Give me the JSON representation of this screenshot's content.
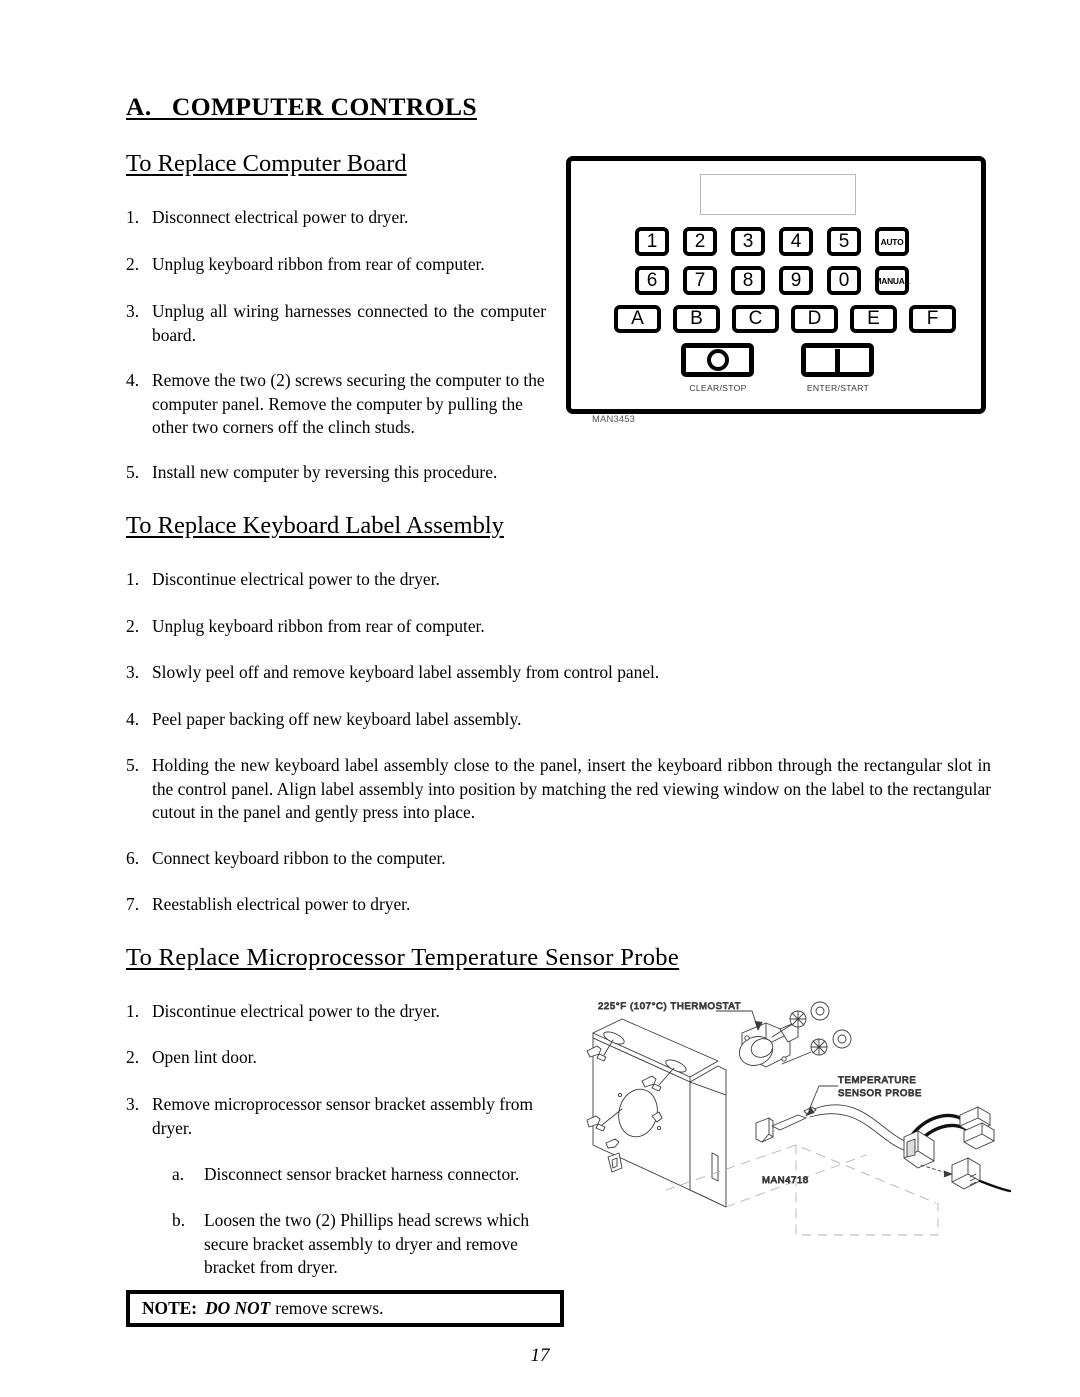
{
  "document": {
    "page_number": "17"
  },
  "section_a": {
    "title": "A.   COMPUTER CONTROLS"
  },
  "computer_board": {
    "heading": "To Replace Computer Board",
    "steps": [
      {
        "num": "1.",
        "text": "Disconnect electrical power to dryer."
      },
      {
        "num": "2.",
        "text": "Unplug keyboard ribbon from rear of computer."
      },
      {
        "num": "3.",
        "text": "Unplug all wiring harnesses connected to the computer board."
      },
      {
        "num": "4.",
        "text": "Remove the two (2) screws securing the computer to the computer panel.  Remove the computer by pulling the other two corners off the clinch studs."
      },
      {
        "num": "5.",
        "text": "Install new computer by reversing this procedure."
      }
    ]
  },
  "keyboard_label": {
    "heading": "To Replace Keyboard Label Assembly",
    "steps": [
      {
        "num": "1.",
        "text": "Discontinue electrical power to the dryer."
      },
      {
        "num": "2.",
        "text": "Unplug keyboard ribbon from rear of computer."
      },
      {
        "num": "3.",
        "text": "Slowly peel off and remove keyboard label assembly from control panel."
      },
      {
        "num": "4.",
        "text": "Peel paper backing off new keyboard label assembly."
      },
      {
        "num": "5.",
        "text": "Holding the new keyboard label assembly close to the panel, insert the keyboard ribbon through the rectangular slot in the control panel.  Align label assembly into position by matching the red viewing window on the label to the rectangular cutout in the panel and gently press into place."
      },
      {
        "num": "6.",
        "text": "Connect keyboard ribbon to the computer."
      },
      {
        "num": "7.",
        "text": "Reestablish electrical power to dryer."
      }
    ]
  },
  "sensor_probe": {
    "heading": "To Replace Microprocessor Temperature Sensor Probe",
    "steps": [
      {
        "num": "1.",
        "text": "Discontinue electrical power to the dryer."
      },
      {
        "num": "2.",
        "text": "Open lint door."
      },
      {
        "num": "3.",
        "text": "Remove microprocessor sensor bracket assembly from dryer."
      }
    ],
    "substeps": [
      {
        "num": "a.",
        "text": "Disconnect sensor bracket harness connector."
      },
      {
        "num": "b.",
        "text": "Loosen the two (2) Phillips head screws which secure bracket assembly to dryer and remove bracket from dryer."
      }
    ]
  },
  "note": {
    "label": "NOTE:",
    "emphasis": "DO NOT",
    "text": "remove screws."
  },
  "keypad_figure": {
    "figure_id": "MAN3453",
    "row1": [
      "1",
      "2",
      "3",
      "4",
      "5",
      "AUTO"
    ],
    "row2": [
      "6",
      "7",
      "8",
      "9",
      "0",
      "MANUAL"
    ],
    "row3": [
      "A",
      "B",
      "C",
      "D",
      "E",
      "F"
    ],
    "clear_stop_caption": "CLEAR/STOP",
    "enter_start_caption": "ENTER/START"
  },
  "probe_figure": {
    "figure_id": "MAN4718",
    "thermostat_label": "225°F (107°C) THERMOSTAT",
    "probe_label_line1": "TEMPERATURE",
    "probe_label_line2": "SENSOR PROBE"
  }
}
